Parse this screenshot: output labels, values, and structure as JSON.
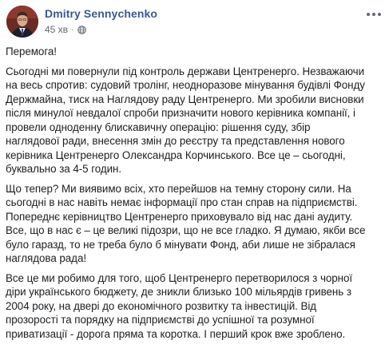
{
  "post": {
    "author": "Dmitry Sennychenko",
    "time": "45 хв",
    "separator": "·",
    "privacy_icon": "globe-icon",
    "options_icon": "more-options-icon",
    "paragraphs": [
      {
        "lines": [
          "Перемога!"
        ]
      },
      {
        "lines": [
          "Сьогодні ми повернули під контроль держави Центренерго. Незважаючи",
          "на весь спротив: судовий тролінг, неодноразове мінування будівлі Фонду",
          "Держмайна, тиск на Наглядову раду Центренерго. Ми зробили висновки",
          "після минулої невдалої спроби призначити нового керівника компанії, і",
          "провели одноденну блискавичну операцію: рішення суду, збір",
          "наглядової ради, внесення змін до реєстру та представлення нового",
          "керівника Центренерго Олександра Корчинського. Все це – сьогодні,",
          "буквально за 4-5 годин."
        ]
      },
      {
        "lines": [
          "Що тепер? Ми виявимо всіх, хто перейшов на темну сторону сили. На",
          "сьогодні в нас навіть немає інформації про стан справ на підприємстві.",
          "Попереднє керівництво Центренерго приховувало від нас дані аудиту.",
          "Все, що в нас є – це великі підозри, що не все гладко. Я думаю, якби все",
          "було гаразд, то не треба було б мінувати Фонд, аби лише не зібралася",
          "наглядова рада!"
        ]
      },
      {
        "lines": [
          "Все це ми робимо для того, щоб Центренерго перетворилося з чорної",
          "діри українського бюджету, де зникли близько 100 мільярдів гривень з",
          "2004 року, на двері до економічного розвитку та інвестицій. Від",
          "прозорості та порядку на підприємстві до успішної та розумної",
          "приватизації - дорога пряма та коротка. І перший крок вже зроблено."
        ]
      }
    ]
  },
  "colors": {
    "author": "#385898",
    "meta": "#616770",
    "text": "#1c1e21"
  }
}
